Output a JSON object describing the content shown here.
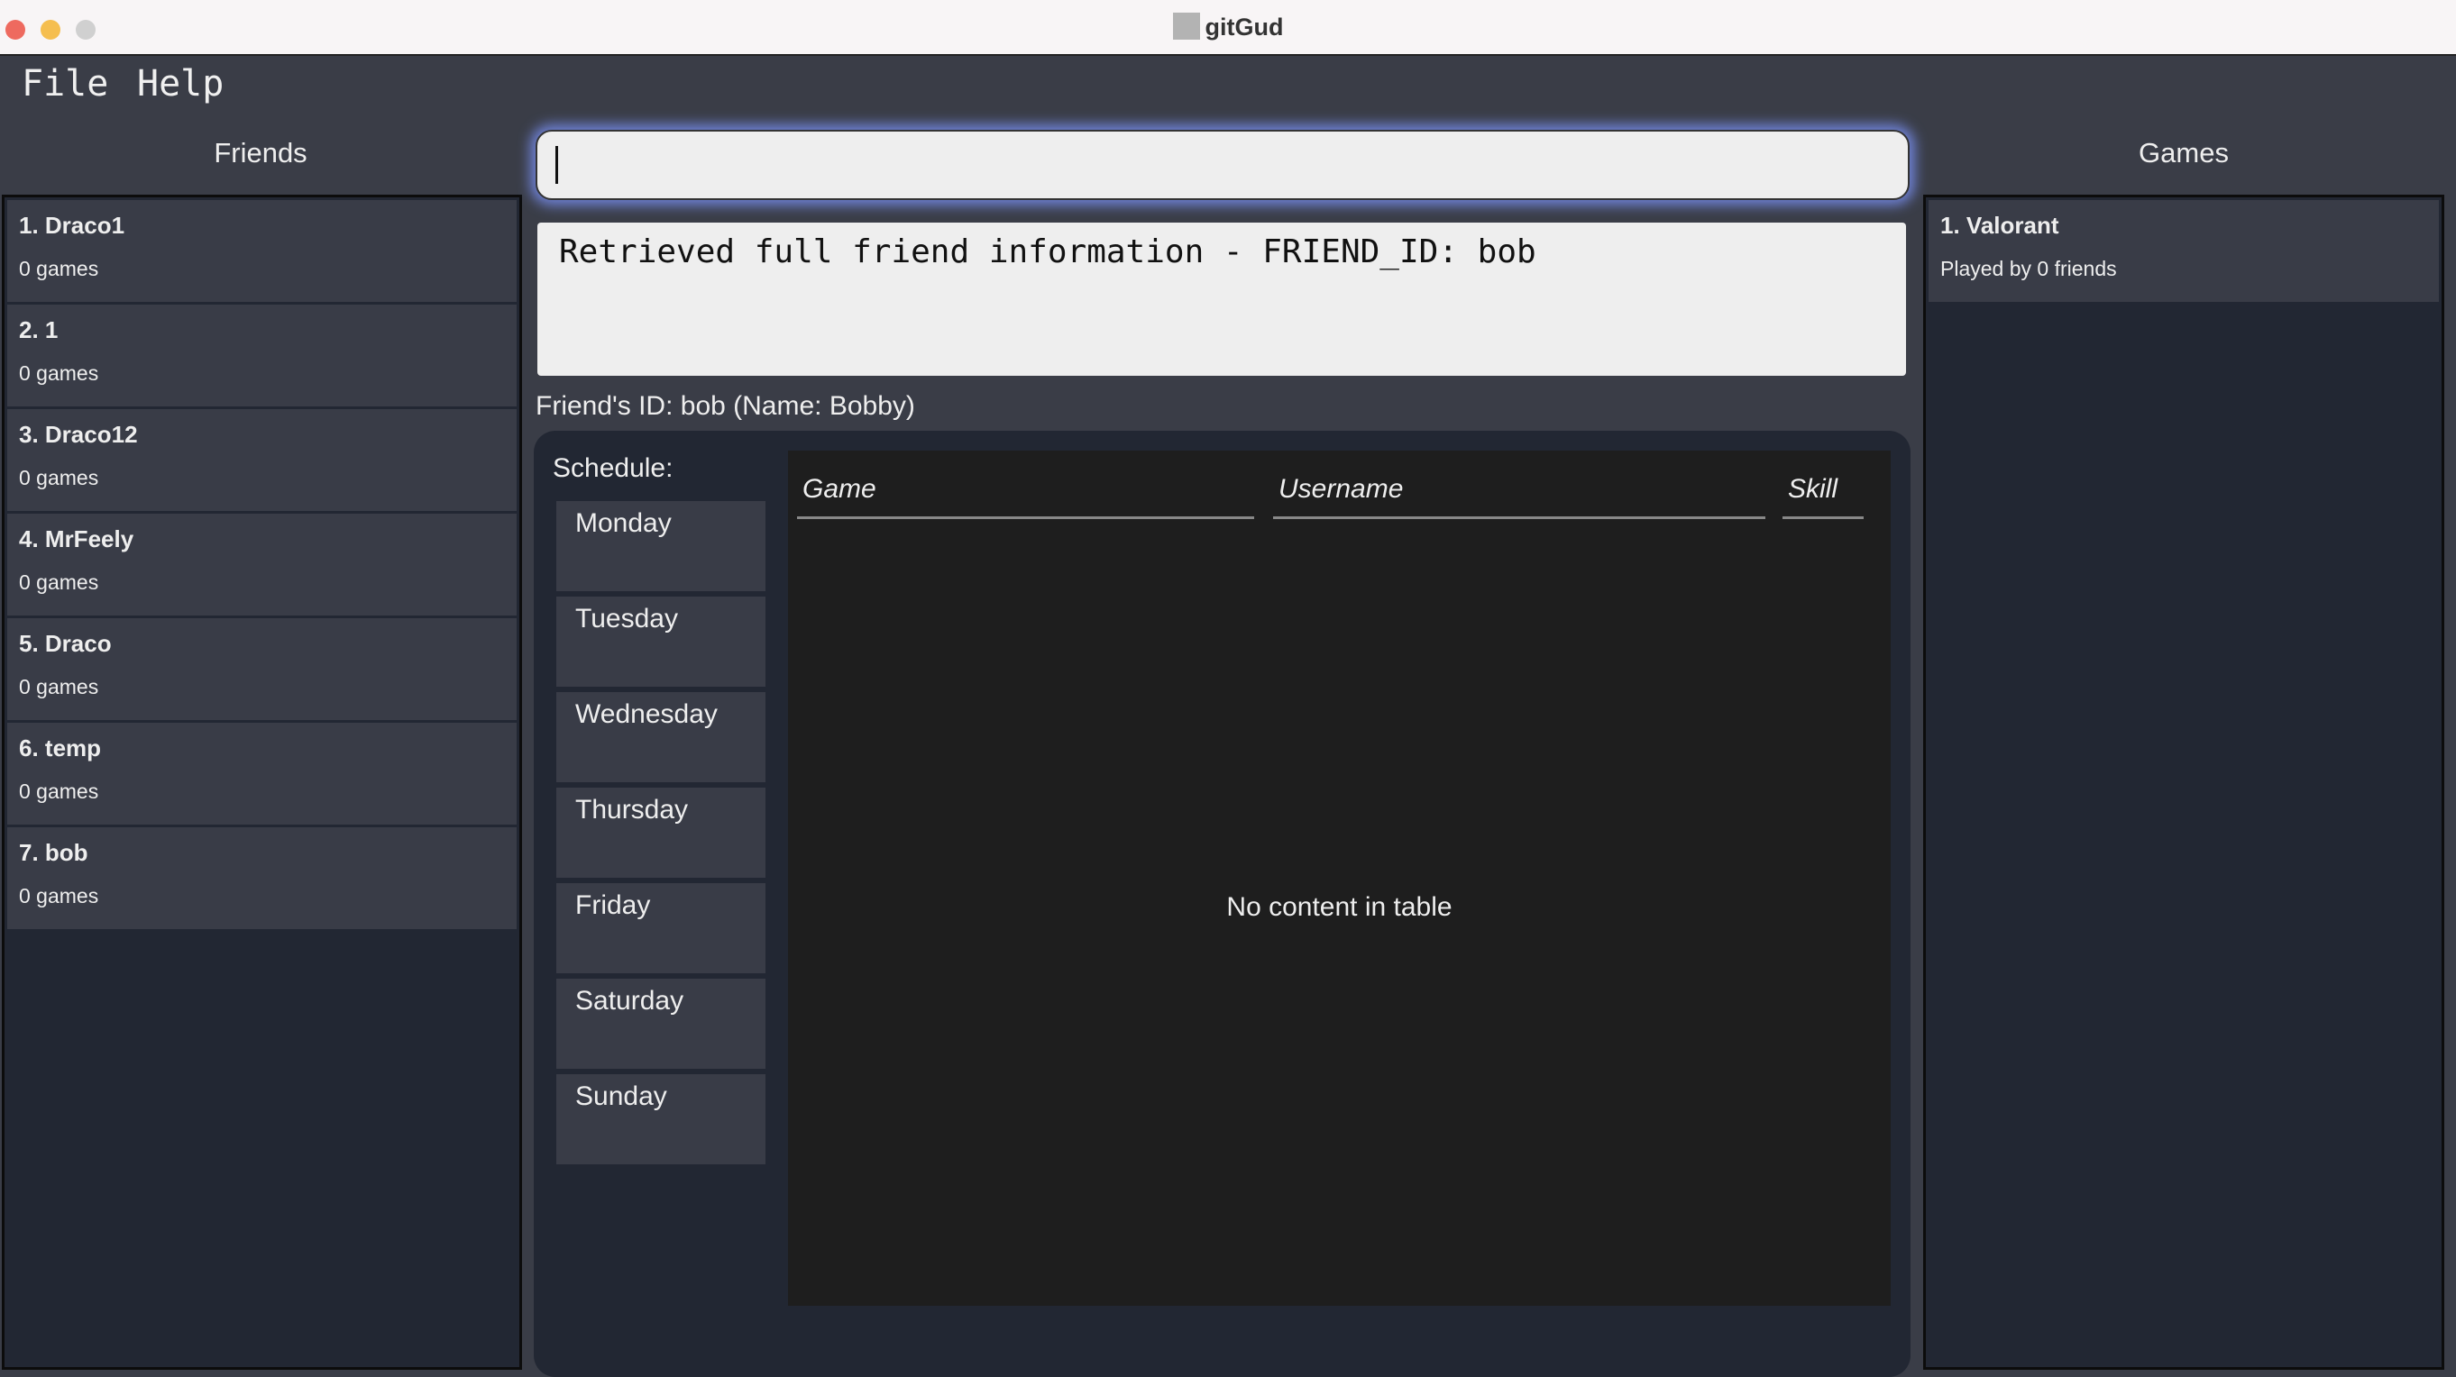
{
  "window": {
    "title": "gitGud",
    "controls": {
      "close": "#ee6a5f",
      "minimize": "#f5be4f",
      "maximize": "#d0d0d0"
    }
  },
  "menu": [
    "File",
    "Help"
  ],
  "friends": {
    "header": "Friends",
    "items": [
      {
        "title": "1. Draco1",
        "subtitle": "0 games"
      },
      {
        "title": "2. 1",
        "subtitle": "0 games"
      },
      {
        "title": "3. Draco12",
        "subtitle": "0 games"
      },
      {
        "title": "4. MrFeely",
        "subtitle": "0 games"
      },
      {
        "title": "5. Draco",
        "subtitle": "0 games"
      },
      {
        "title": "6. temp",
        "subtitle": "0 games"
      },
      {
        "title": "7. bob",
        "subtitle": "0 games"
      }
    ]
  },
  "command": {
    "value": "",
    "placeholder": ""
  },
  "result": {
    "text": "Retrieved full friend information - FRIEND_ID: bob"
  },
  "detail": {
    "friend_id_label": "Friend's ID: bob (Name: Bobby)",
    "schedule_label": "Schedule:",
    "days": [
      "Monday",
      "Tuesday",
      "Wednesday",
      "Thursday",
      "Friday",
      "Saturday",
      "Sunday"
    ],
    "table": {
      "columns": [
        "Game",
        "Username",
        "Skill"
      ],
      "rows": [],
      "empty_text": "No content in table"
    }
  },
  "games": {
    "header": "Games",
    "items": [
      {
        "title": "1. Valorant",
        "subtitle": "Played by 0 friends"
      }
    ]
  }
}
